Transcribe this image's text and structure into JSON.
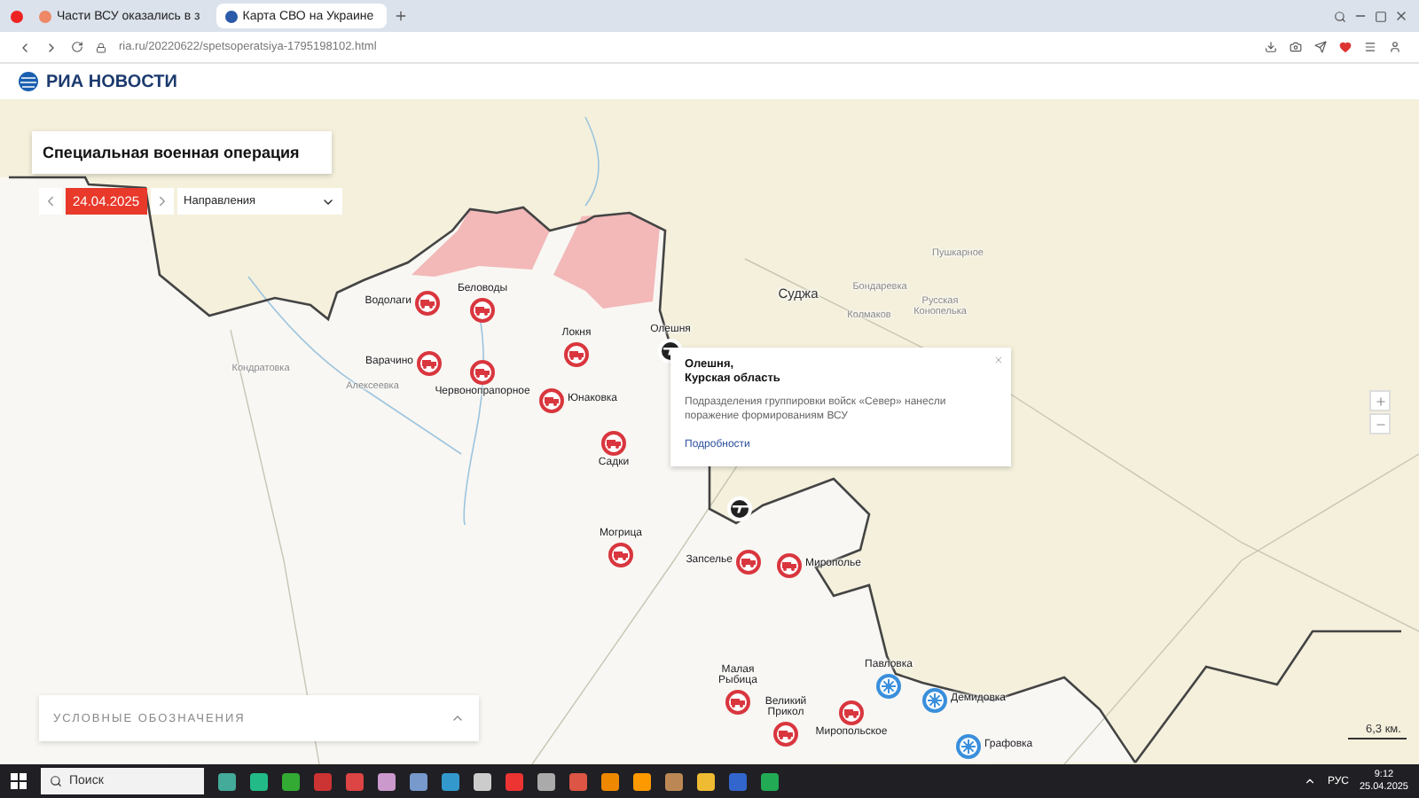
{
  "browser": {
    "tabs": [
      {
        "title": "Части ВСУ оказались в з",
        "selected": false
      },
      {
        "title": "Карта СВО на Украине",
        "selected": true
      }
    ],
    "url": "ria.ru/20220622/spetsoperatsiya-1795198102.html"
  },
  "site": {
    "logo": "РИА НОВОСТИ"
  },
  "map": {
    "title": "Специальная военная операция",
    "date": "24.04.2025",
    "direction_select": "Направления",
    "places": [
      {
        "name": "Суджа",
        "major": true
      },
      {
        "name": "Бондаревка",
        "major": false
      },
      {
        "name": "Пушкарное",
        "major": false
      },
      {
        "name": "Русская Конопелька",
        "major": false
      },
      {
        "name": "Колмаков",
        "major": false
      },
      {
        "name": "Кондратовка",
        "major": false
      },
      {
        "name": "Алексеевка",
        "major": false
      }
    ],
    "markers": [
      {
        "label": "Водолаги",
        "kind": "truck"
      },
      {
        "label": "Беловоды",
        "kind": "truck"
      },
      {
        "label": "Варачино",
        "kind": "truck"
      },
      {
        "label": "Червонопрапорное",
        "kind": "truck"
      },
      {
        "label": "Локня",
        "kind": "truck"
      },
      {
        "label": "Юнаковка",
        "kind": "truck"
      },
      {
        "label": "Садки",
        "kind": "truck"
      },
      {
        "label": "Олешня",
        "kind": "rifle"
      },
      {
        "kind": "rifle"
      },
      {
        "label": "Могрица",
        "kind": "truck"
      },
      {
        "label": "Запселье",
        "kind": "truck"
      },
      {
        "label": "Мирополье",
        "kind": "truck"
      },
      {
        "label": "Малая Рыбица",
        "kind": "truck"
      },
      {
        "label": "Великий Прикол",
        "kind": "truck"
      },
      {
        "label": "Миропольское",
        "kind": "truck"
      },
      {
        "label": "Павловка",
        "kind": "burst"
      },
      {
        "label": "Демидовка",
        "kind": "burst"
      },
      {
        "label": "Графовка",
        "kind": "burst"
      }
    ],
    "popup": {
      "title_lines": [
        "Олешня,",
        "Курская область"
      ],
      "text": "Подразделения группировки войск «Север» нанесли поражение формированиям ВСУ",
      "link": "Подробности"
    },
    "legend": {
      "title": "УСЛОВНЫЕ ОБОЗНАЧЕНИЯ",
      "expanded": false
    },
    "scale": "6,3 км."
  },
  "taskbar": {
    "search": "Поиск",
    "language": "РУС",
    "time": "9:12",
    "date": "25.04.2025"
  }
}
